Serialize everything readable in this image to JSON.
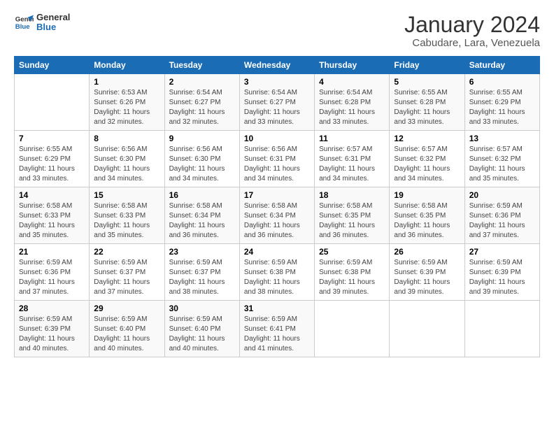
{
  "logo": {
    "line1": "General",
    "line2": "Blue"
  },
  "title": "January 2024",
  "subtitle": "Cabudare, Lara, Venezuela",
  "days_of_week": [
    "Sunday",
    "Monday",
    "Tuesday",
    "Wednesday",
    "Thursday",
    "Friday",
    "Saturday"
  ],
  "weeks": [
    [
      {
        "day": "",
        "info": ""
      },
      {
        "day": "1",
        "info": "Sunrise: 6:53 AM\nSunset: 6:26 PM\nDaylight: 11 hours\nand 32 minutes."
      },
      {
        "day": "2",
        "info": "Sunrise: 6:54 AM\nSunset: 6:27 PM\nDaylight: 11 hours\nand 32 minutes."
      },
      {
        "day": "3",
        "info": "Sunrise: 6:54 AM\nSunset: 6:27 PM\nDaylight: 11 hours\nand 33 minutes."
      },
      {
        "day": "4",
        "info": "Sunrise: 6:54 AM\nSunset: 6:28 PM\nDaylight: 11 hours\nand 33 minutes."
      },
      {
        "day": "5",
        "info": "Sunrise: 6:55 AM\nSunset: 6:28 PM\nDaylight: 11 hours\nand 33 minutes."
      },
      {
        "day": "6",
        "info": "Sunrise: 6:55 AM\nSunset: 6:29 PM\nDaylight: 11 hours\nand 33 minutes."
      }
    ],
    [
      {
        "day": "7",
        "info": "Sunrise: 6:55 AM\nSunset: 6:29 PM\nDaylight: 11 hours\nand 33 minutes."
      },
      {
        "day": "8",
        "info": "Sunrise: 6:56 AM\nSunset: 6:30 PM\nDaylight: 11 hours\nand 34 minutes."
      },
      {
        "day": "9",
        "info": "Sunrise: 6:56 AM\nSunset: 6:30 PM\nDaylight: 11 hours\nand 34 minutes."
      },
      {
        "day": "10",
        "info": "Sunrise: 6:56 AM\nSunset: 6:31 PM\nDaylight: 11 hours\nand 34 minutes."
      },
      {
        "day": "11",
        "info": "Sunrise: 6:57 AM\nSunset: 6:31 PM\nDaylight: 11 hours\nand 34 minutes."
      },
      {
        "day": "12",
        "info": "Sunrise: 6:57 AM\nSunset: 6:32 PM\nDaylight: 11 hours\nand 34 minutes."
      },
      {
        "day": "13",
        "info": "Sunrise: 6:57 AM\nSunset: 6:32 PM\nDaylight: 11 hours\nand 35 minutes."
      }
    ],
    [
      {
        "day": "14",
        "info": "Sunrise: 6:58 AM\nSunset: 6:33 PM\nDaylight: 11 hours\nand 35 minutes."
      },
      {
        "day": "15",
        "info": "Sunrise: 6:58 AM\nSunset: 6:33 PM\nDaylight: 11 hours\nand 35 minutes."
      },
      {
        "day": "16",
        "info": "Sunrise: 6:58 AM\nSunset: 6:34 PM\nDaylight: 11 hours\nand 36 minutes."
      },
      {
        "day": "17",
        "info": "Sunrise: 6:58 AM\nSunset: 6:34 PM\nDaylight: 11 hours\nand 36 minutes."
      },
      {
        "day": "18",
        "info": "Sunrise: 6:58 AM\nSunset: 6:35 PM\nDaylight: 11 hours\nand 36 minutes."
      },
      {
        "day": "19",
        "info": "Sunrise: 6:58 AM\nSunset: 6:35 PM\nDaylight: 11 hours\nand 36 minutes."
      },
      {
        "day": "20",
        "info": "Sunrise: 6:59 AM\nSunset: 6:36 PM\nDaylight: 11 hours\nand 37 minutes."
      }
    ],
    [
      {
        "day": "21",
        "info": "Sunrise: 6:59 AM\nSunset: 6:36 PM\nDaylight: 11 hours\nand 37 minutes."
      },
      {
        "day": "22",
        "info": "Sunrise: 6:59 AM\nSunset: 6:37 PM\nDaylight: 11 hours\nand 37 minutes."
      },
      {
        "day": "23",
        "info": "Sunrise: 6:59 AM\nSunset: 6:37 PM\nDaylight: 11 hours\nand 38 minutes."
      },
      {
        "day": "24",
        "info": "Sunrise: 6:59 AM\nSunset: 6:38 PM\nDaylight: 11 hours\nand 38 minutes."
      },
      {
        "day": "25",
        "info": "Sunrise: 6:59 AM\nSunset: 6:38 PM\nDaylight: 11 hours\nand 39 minutes."
      },
      {
        "day": "26",
        "info": "Sunrise: 6:59 AM\nSunset: 6:39 PM\nDaylight: 11 hours\nand 39 minutes."
      },
      {
        "day": "27",
        "info": "Sunrise: 6:59 AM\nSunset: 6:39 PM\nDaylight: 11 hours\nand 39 minutes."
      }
    ],
    [
      {
        "day": "28",
        "info": "Sunrise: 6:59 AM\nSunset: 6:39 PM\nDaylight: 11 hours\nand 40 minutes."
      },
      {
        "day": "29",
        "info": "Sunrise: 6:59 AM\nSunset: 6:40 PM\nDaylight: 11 hours\nand 40 minutes."
      },
      {
        "day": "30",
        "info": "Sunrise: 6:59 AM\nSunset: 6:40 PM\nDaylight: 11 hours\nand 40 minutes."
      },
      {
        "day": "31",
        "info": "Sunrise: 6:59 AM\nSunset: 6:41 PM\nDaylight: 11 hours\nand 41 minutes."
      },
      {
        "day": "",
        "info": ""
      },
      {
        "day": "",
        "info": ""
      },
      {
        "day": "",
        "info": ""
      }
    ]
  ]
}
